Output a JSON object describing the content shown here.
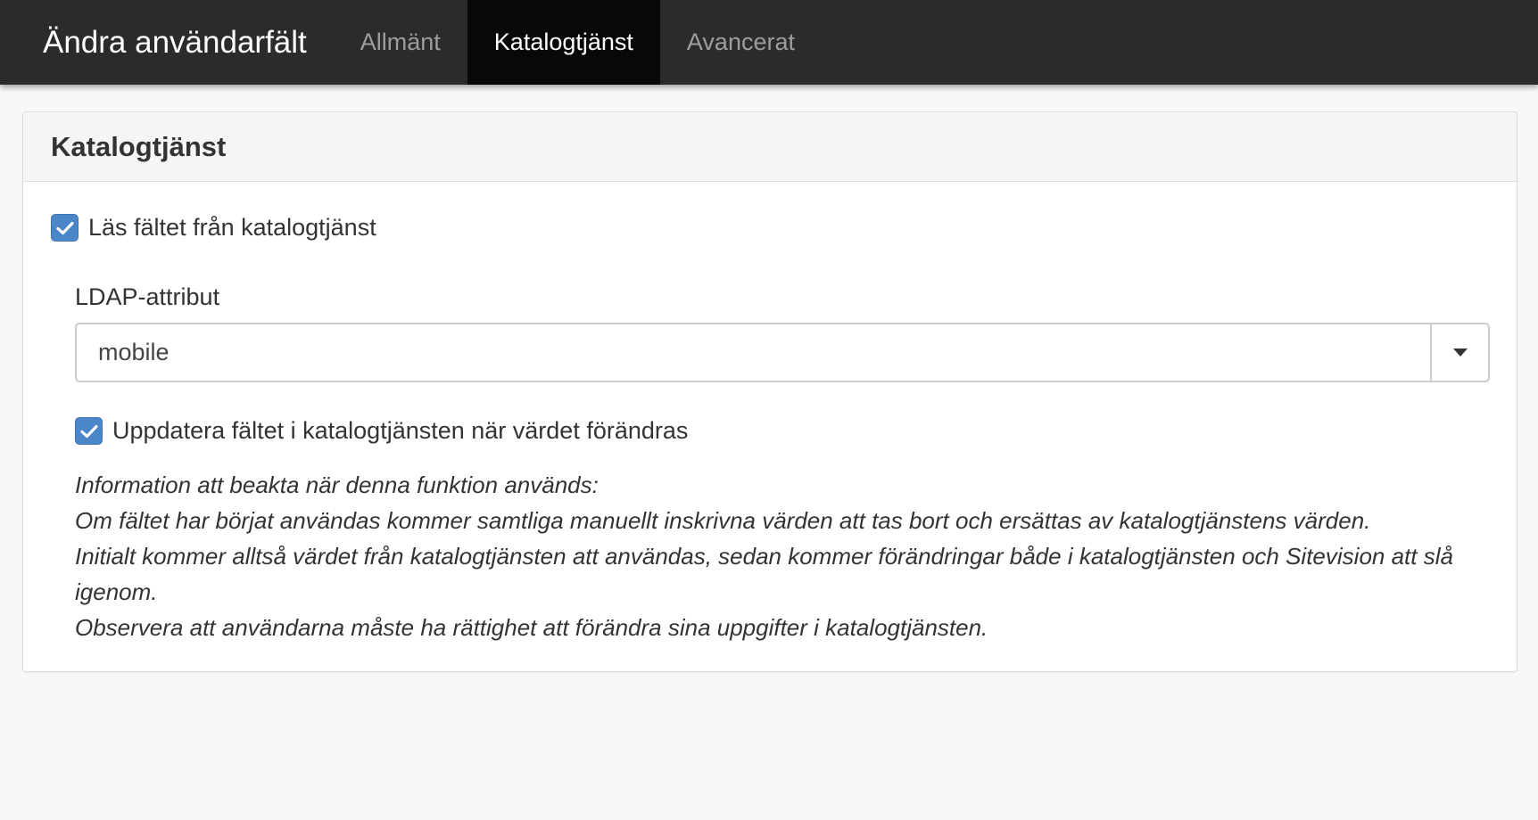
{
  "navbar": {
    "title": "Ändra användarfält",
    "tabs": [
      {
        "label": "Allmänt",
        "active": false
      },
      {
        "label": "Katalogtjänst",
        "active": true
      },
      {
        "label": "Avancerat",
        "active": false
      }
    ]
  },
  "panel": {
    "title": "Katalogtjänst",
    "read_from_directory": {
      "label": "Läs fältet från katalogtjänst",
      "checked": true
    },
    "ldap_attribute": {
      "label": "LDAP-attribut",
      "value": "mobile"
    },
    "update_directory": {
      "label": "Uppdatera fältet i katalogtjänsten när värdet förändras",
      "checked": true
    },
    "info_lines": [
      "Information att beakta när denna funktion används:",
      "Om fältet har börjat användas kommer samtliga manuellt inskrivna värden att tas bort och ersättas av katalogtjänstens värden.",
      "Initialt kommer alltså värdet från katalogtjänsten att användas, sedan kommer förändringar både i katalogtjänsten och Sitevision att slå igenom.",
      "Observera att användarna måste ha rättighet att förändra sina uppgifter i katalogtjänsten."
    ]
  },
  "colors": {
    "navbar_bg": "#2b2b2b",
    "active_tab_bg": "#080808",
    "checkbox_blue": "#4a86c8",
    "page_bg": "#f8f8f8"
  },
  "icons": {
    "checkbox": "check-icon",
    "select_toggle": "caret-down-icon"
  }
}
